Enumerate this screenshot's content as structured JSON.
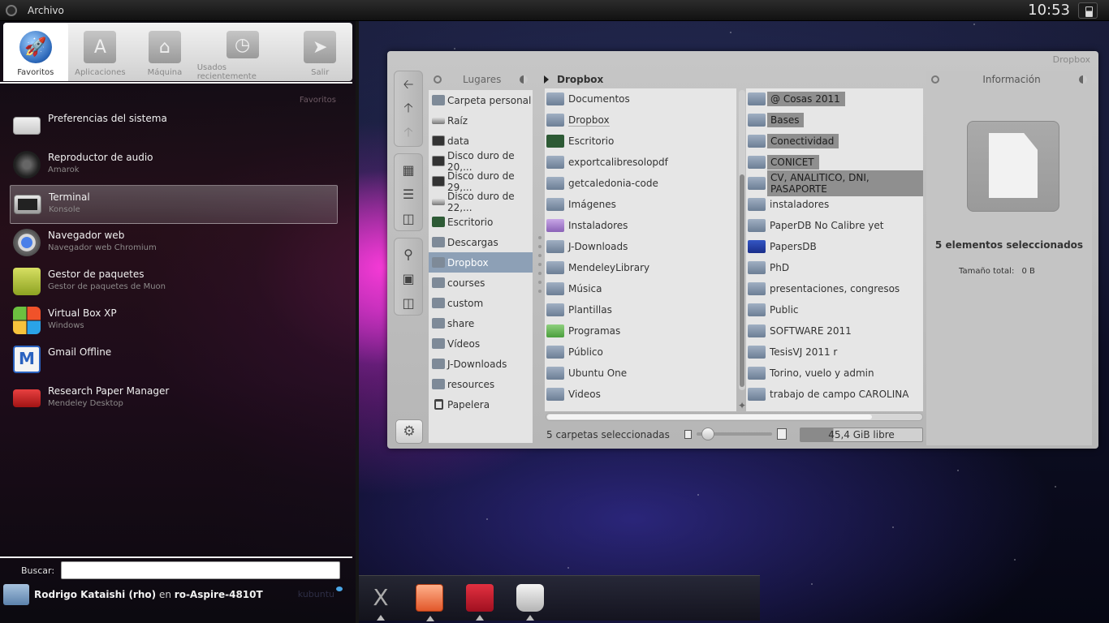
{
  "top_panel": {
    "app_menu_label": "Archivo",
    "clock": "10:53",
    "battery_icon": "battery-icon"
  },
  "launcher": {
    "tabs": [
      {
        "label": "Favoritos",
        "icon": "rocket-icon",
        "active": true
      },
      {
        "label": "Aplicaciones",
        "icon": "app-store-icon",
        "active": false
      },
      {
        "label": "Máquina",
        "icon": "home-icon",
        "active": false
      },
      {
        "label": "Usados recientemente",
        "icon": "clock-icon",
        "active": false
      },
      {
        "label": "Salir",
        "icon": "exit-icon",
        "active": false
      }
    ],
    "section_label": "Favoritos",
    "favorites": [
      {
        "title": "Preferencias del sistema",
        "subtitle": "",
        "icon": "system-preferences-icon"
      },
      {
        "title": "Reproductor de audio",
        "subtitle": "Amarok",
        "icon": "audio-player-icon"
      },
      {
        "title": "Terminal",
        "subtitle": "Konsole",
        "icon": "terminal-icon",
        "selected": true
      },
      {
        "title": "Navegador web",
        "subtitle": "Navegador web Chromium",
        "icon": "chromium-icon"
      },
      {
        "title": "Gestor de paquetes",
        "subtitle": "Gestor de paquetes de Muon",
        "icon": "package-manager-icon"
      },
      {
        "title": "Virtual Box XP",
        "subtitle": "Windows",
        "icon": "windows-icon"
      },
      {
        "title": "Gmail Offline",
        "subtitle": "",
        "icon": "gmail-icon"
      },
      {
        "title": "Research Paper Manager",
        "subtitle": "Mendeley Desktop",
        "icon": "mendeley-icon"
      }
    ],
    "search": {
      "label": "Buscar:",
      "value": ""
    },
    "user": {
      "name": "Rodrigo Kataishi (rho)",
      "connector": "en",
      "host": "ro-Aspire-4810T"
    },
    "distro_logo": "kubuntu"
  },
  "file_manager": {
    "window_title": "Dropbox",
    "places_header": "Lugares",
    "places": [
      {
        "label": "Carpeta personal",
        "kind": "folder"
      },
      {
        "label": "Raíz",
        "kind": "drive"
      },
      {
        "label": "data",
        "kind": "dev"
      },
      {
        "label": "Disco duro de 20,...",
        "kind": "dev"
      },
      {
        "label": "Disco duro de 29,...",
        "kind": "dev"
      },
      {
        "label": "Disco duro de 22,...",
        "kind": "drive"
      },
      {
        "label": "Escritorio",
        "kind": "desk"
      },
      {
        "label": "Descargas",
        "kind": "folder"
      },
      {
        "label": "Dropbox",
        "kind": "folder",
        "selected": true
      },
      {
        "label": "courses",
        "kind": "folder"
      },
      {
        "label": "custom",
        "kind": "folder"
      },
      {
        "label": "share",
        "kind": "folder"
      },
      {
        "label": "Vídeos",
        "kind": "folder"
      },
      {
        "label": "J-Downloads",
        "kind": "folder"
      },
      {
        "label": "resources",
        "kind": "folder"
      },
      {
        "label": "Papelera",
        "kind": "trash"
      }
    ],
    "column1_header": "Dropbox",
    "column1": [
      {
        "label": "Documentos",
        "kind": "folder"
      },
      {
        "label": "Dropbox",
        "kind": "folder",
        "underline": true
      },
      {
        "label": "Escritorio",
        "kind": "desk"
      },
      {
        "label": "exportcalibresolopdf",
        "kind": "folder"
      },
      {
        "label": "getcaledonia-code",
        "kind": "folder"
      },
      {
        "label": "Imágenes",
        "kind": "folder"
      },
      {
        "label": "Instaladores",
        "kind": "purple"
      },
      {
        "label": "J-Downloads",
        "kind": "folder"
      },
      {
        "label": "MendeleyLibrary",
        "kind": "folder"
      },
      {
        "label": "Música",
        "kind": "folder"
      },
      {
        "label": "Plantillas",
        "kind": "folder"
      },
      {
        "label": "Programas",
        "kind": "green"
      },
      {
        "label": "Público",
        "kind": "folder"
      },
      {
        "label": "Ubuntu One",
        "kind": "folder"
      },
      {
        "label": "Videos",
        "kind": "folder"
      }
    ],
    "column2": [
      {
        "label": "@ Cosas 2011",
        "kind": "folder",
        "selected": true
      },
      {
        "label": "Bases",
        "kind": "folder",
        "selected": true
      },
      {
        "label": "Conectividad",
        "kind": "folder",
        "selected": true
      },
      {
        "label": "CONICET",
        "kind": "folder",
        "selected": true
      },
      {
        "label": "CV, ANALITICO, DNI, PASAPORTE",
        "kind": "folder",
        "selected": true
      },
      {
        "label": "instaladores",
        "kind": "folder"
      },
      {
        "label": "PaperDB No Calibre yet",
        "kind": "folder"
      },
      {
        "label": "PapersDB",
        "kind": "blue"
      },
      {
        "label": "PhD",
        "kind": "folder"
      },
      {
        "label": "presentaciones, congresos",
        "kind": "folder"
      },
      {
        "label": "Public",
        "kind": "folder"
      },
      {
        "label": "SOFTWARE 2011",
        "kind": "folder"
      },
      {
        "label": "TesisVJ 2011 r",
        "kind": "folder"
      },
      {
        "label": "Torino, vuelo y admin",
        "kind": "folder"
      },
      {
        "label": "trabajo de campo CAROLINA",
        "kind": "folder"
      }
    ],
    "info_header": "Información",
    "info_selection": "5 elementos seleccionados",
    "info_size_label": "Tamaño total:",
    "info_size_value": "0 B",
    "status_text": "5 carpetas seleccionadas",
    "free_space": "45,4 GiB libre",
    "free_space_used_fraction": 0.27
  },
  "dock": {
    "items": [
      {
        "name": "x-app-icon",
        "glyph": "X"
      },
      {
        "name": "impress-icon"
      },
      {
        "name": "mendeley-icon"
      },
      {
        "name": "finder-icon"
      }
    ]
  }
}
